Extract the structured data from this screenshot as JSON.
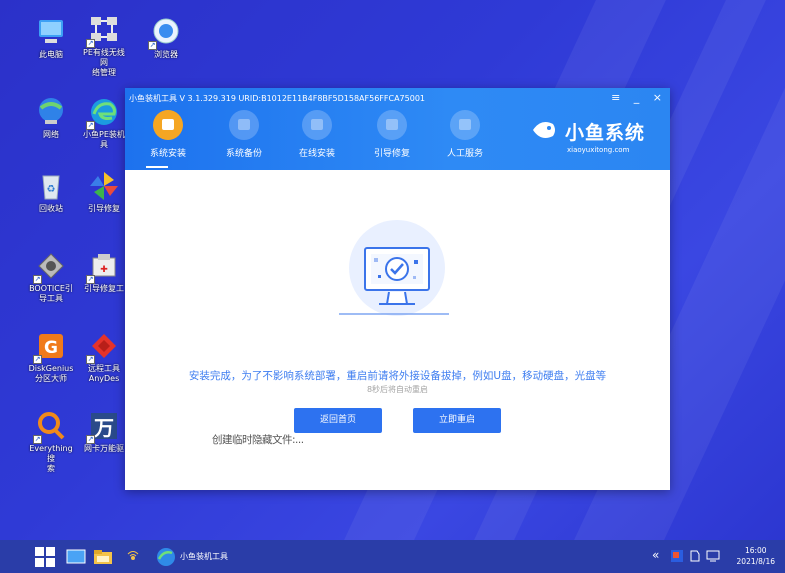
{
  "desktop": {
    "icons": [
      {
        "label": "此电脑",
        "icon": "computer-icon"
      },
      {
        "label": "PE有线无线网\n络管理",
        "icon": "network-manager-icon"
      },
      {
        "label": "浏览器",
        "icon": "browser-icon"
      },
      {
        "label": "网络",
        "icon": "network-icon"
      },
      {
        "label": "小鱼PE装机\n具",
        "icon": "edge-icon"
      },
      {
        "label": "回收站",
        "icon": "recycle-bin-icon"
      },
      {
        "label": "引导修复",
        "icon": "pinwheel-icon"
      },
      {
        "label": "BOOTICE引\n导工具",
        "icon": "bootice-icon"
      },
      {
        "label": "引导修复工",
        "icon": "bootfix-tool-icon"
      },
      {
        "label": "DiskGenius\n分区大师",
        "icon": "diskgenius-icon"
      },
      {
        "label": "远程工具\nAnyDes",
        "icon": "anydesk-icon"
      },
      {
        "label": "Everything搜\n索",
        "icon": "everything-search-icon"
      },
      {
        "label": "网卡万能驱",
        "icon": "wan-driver-icon"
      }
    ]
  },
  "window": {
    "title": "小鱼装机工具 V 3.1.329.319 URID:B1012E11B4F8BF5D158AF56FFCA75001",
    "controls": {
      "menu": "≡",
      "minimize": "_",
      "close": "×"
    },
    "nav": [
      {
        "label": "系统安装",
        "icon": "system-install-icon",
        "active": true
      },
      {
        "label": "系统备份",
        "icon": "system-backup-icon",
        "active": false
      },
      {
        "label": "在线安装",
        "icon": "online-install-icon",
        "active": false
      },
      {
        "label": "引导修复",
        "icon": "boot-repair-icon",
        "active": false
      },
      {
        "label": "人工服务",
        "icon": "support-chat-icon",
        "active": false
      }
    ],
    "brand": {
      "name": "小鱼系统",
      "url": "xiaoyuxitong.com"
    },
    "message": "安装完成，为了不影响系统部署，重启前请将外接设备拔掉，例如U盘，移动硬盘，光盘等",
    "countdown": "8秒后将自动重启",
    "buttons": {
      "back": "返回首页",
      "restart": "立即重启"
    }
  },
  "overlay_text": "创建临时隐藏文件:...",
  "taskbar": {
    "app_label": "小鱼装机工具",
    "chevron": "«",
    "time": "16:00",
    "date": "2021/8/16"
  },
  "colors": {
    "accent": "#2d72f0",
    "active_nav": "#f5a623",
    "header": "#1d72ee"
  }
}
